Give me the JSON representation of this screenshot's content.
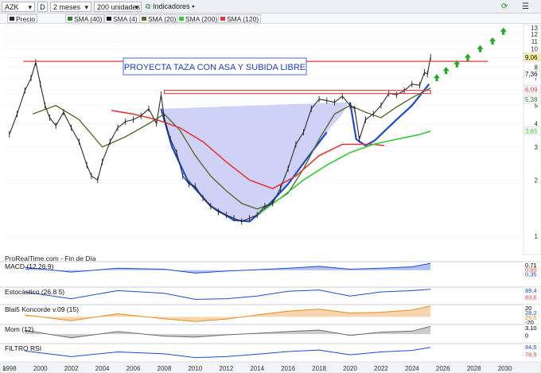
{
  "toolbar": {
    "ticker": "AZK",
    "mode_icon": "D",
    "period": "2 meses",
    "units": "200 unidades",
    "indicators": "Indicadores"
  },
  "legend": [
    {
      "label": "Precio",
      "color": "#2a2a2a"
    },
    {
      "label": "SMA (40)",
      "color": "#2e7d32"
    },
    {
      "label": "SMA (4)",
      "color": "#111111"
    },
    {
      "label": "SMA (20)",
      "color": "#556b2f"
    },
    {
      "label": "SMA (200)",
      "color": "#33cc33"
    },
    {
      "label": "SMA (120)",
      "color": "#e53935"
    }
  ],
  "annotation": "PROYECTA TAZA CON ASA Y SUBIDA LIBRE",
  "source": "ProRealTime.com - Fin de Día",
  "price_labels": [
    {
      "text": "9,06",
      "value": 9.06,
      "bg": "#fff3a0",
      "fg": "#000000"
    },
    {
      "text": "7,36",
      "value": 7.36,
      "bg": "#ffffff",
      "fg": "#111111"
    },
    {
      "text": "6,09",
      "value": 6.09,
      "bg": "#ffffff",
      "fg": "#e53935"
    },
    {
      "text": "5,38",
      "value": 5.38,
      "bg": "#ffffff",
      "fg": "#2e7d32"
    },
    {
      "text": "3,65",
      "value": 3.65,
      "bg": "#ffffff",
      "fg": "#33cc33"
    }
  ],
  "panels": [
    {
      "label": "MACD (12.26.9)",
      "axis": [
        "0,71",
        "0,65",
        "0,35"
      ],
      "axis_colors": [
        "#000000",
        "#e53935",
        "#1e4bd2"
      ]
    },
    {
      "label": "Estocástico (26.8 5)",
      "axis": [
        "89,4",
        "83,6"
      ],
      "axis_colors": [
        "#1e4bd2",
        "#e53935"
      ]
    },
    {
      "label": "Blai5 Koncorde v.09 (15)",
      "axis": [
        "20",
        "28,2",
        "25,5",
        "-20"
      ],
      "axis_colors": [
        "#000000",
        "#1e4bd2",
        "#e88a1a",
        "#000000"
      ]
    },
    {
      "label": "Mom (12)",
      "axis": [
        "3,10",
        "0"
      ],
      "axis_colors": [
        "#000000",
        "#000000"
      ]
    },
    {
      "label": "FILTRO RSI",
      "axis": [
        "84,6",
        "78,5"
      ],
      "axis_colors": [
        "#1e4bd2",
        "#e53935"
      ]
    }
  ],
  "chart_data": {
    "type": "line",
    "title": "AZK",
    "scale": "log",
    "ylim": [
      0.8,
      13.5
    ],
    "y_ticks": [
      1,
      2,
      3,
      4,
      5,
      6,
      7,
      8,
      9,
      10,
      11,
      12,
      13
    ],
    "x_ticks": [
      1998,
      2000,
      2002,
      2004,
      2006,
      2008,
      2010,
      2012,
      2014,
      2016,
      2018,
      2020,
      2022,
      2024,
      2026,
      2028,
      2030
    ],
    "xlim": [
      1997.6,
      2031.2
    ],
    "series": [
      {
        "name": "Precio",
        "color": "#2a2a2a",
        "x": [
          1998.0,
          1998.5,
          1999.0,
          1999.4,
          1999.7,
          2000.0,
          2000.3,
          2000.6,
          2001.0,
          2001.5,
          2002.0,
          2002.5,
          2003.0,
          2003.3,
          2003.7,
          2004.0,
          2004.5,
          2005.0,
          2005.5,
          2006.0,
          2006.5,
          2007.0,
          2007.5,
          2007.8,
          2008.0,
          2008.4,
          2008.8,
          2009.2,
          2009.6,
          2010.0,
          2010.5,
          2011.0,
          2011.5,
          2012.0,
          2012.5,
          2013.0,
          2013.5,
          2014.0,
          2014.5,
          2015.0,
          2015.5,
          2016.0,
          2016.5,
          2017.0,
          2017.5,
          2018.0,
          2018.5,
          2019.0,
          2019.5,
          2020.0,
          2020.3,
          2020.6,
          2021.0,
          2021.5,
          2022.0,
          2022.5,
          2023.0,
          2023.5,
          2024.0,
          2024.5,
          2024.8,
          2025.0,
          2025.2
        ],
        "y": [
          3.5,
          4.5,
          6.0,
          7.0,
          8.5,
          6.5,
          5.0,
          4.3,
          3.9,
          4.6,
          3.8,
          3.2,
          2.4,
          2.1,
          2.0,
          2.5,
          3.2,
          3.8,
          4.1,
          4.2,
          4.4,
          4.8,
          4.0,
          5.7,
          4.3,
          3.3,
          2.8,
          2.1,
          1.9,
          1.85,
          1.6,
          1.45,
          1.35,
          1.3,
          1.25,
          1.2,
          1.25,
          1.3,
          1.45,
          1.5,
          1.8,
          2.3,
          3.1,
          3.6,
          4.8,
          5.4,
          5.3,
          5.2,
          5.6,
          5.0,
          4.8,
          3.3,
          4.2,
          4.5,
          5.0,
          5.8,
          5.7,
          6.0,
          6.5,
          6.4,
          7.5,
          7.36,
          9.06
        ]
      },
      {
        "name": "SMA (20)",
        "color": "#556b2f",
        "x": [
          1999.5,
          2001,
          2002.5,
          2004,
          2005.5,
          2007,
          2008,
          2009,
          2010,
          2011,
          2012,
          2013,
          2014,
          2015,
          2016,
          2017,
          2018,
          2019,
          2020,
          2021,
          2022,
          2023,
          2024,
          2025.2
        ],
        "y": [
          4.5,
          5.0,
          4.2,
          3.0,
          3.4,
          4.0,
          4.5,
          3.7,
          2.7,
          2.1,
          1.75,
          1.5,
          1.4,
          1.5,
          1.7,
          2.3,
          3.3,
          4.5,
          5.0,
          4.6,
          4.3,
          4.9,
          5.5,
          6.2
        ]
      },
      {
        "name": "SMA (120)",
        "color": "#e53935",
        "x": [
          2004.6,
          2006,
          2007.5,
          2009,
          2010.5,
          2012,
          2013.5,
          2015,
          2016.5,
          2018,
          2019.5,
          2020.5,
          2021.5,
          2022.2
        ],
        "y": [
          4.7,
          4.5,
          4.2,
          3.8,
          3.2,
          2.5,
          2.0,
          1.8,
          2.1,
          2.7,
          3.1,
          3.1,
          3.1,
          3.05
        ]
      },
      {
        "name": "SMA (200)",
        "color": "#33cc33",
        "x": [
          2014.0,
          2015.5,
          2017,
          2018.5,
          2020,
          2021.5,
          2023,
          2024.5,
          2025.2
        ],
        "y": [
          1.3,
          1.6,
          2.0,
          2.4,
          2.8,
          3.1,
          3.3,
          3.5,
          3.65
        ]
      }
    ],
    "projection_arrows": {
      "color": "#22aa22",
      "x": [
        2025.6,
        2026.2,
        2026.9,
        2027.6,
        2028.4,
        2029.2,
        2029.9
      ],
      "y": [
        7.0,
        7.65,
        8.3,
        9.0,
        10.0,
        11.0,
        12.4
      ]
    },
    "resistance_lines": [
      {
        "color": "#e53935",
        "x": [
          1998.9,
          2028.9
        ],
        "y": [
          8.6,
          8.6
        ]
      },
      {
        "color": "#e53935",
        "x": [
          2008.0,
          2025.2
        ],
        "y": [
          5.9,
          5.9
        ],
        "style": "double"
      }
    ],
    "cup_pattern": {
      "color": "#1e4bd2",
      "fill": "#c7c9f4",
      "x": [
        2007.8,
        2008.5,
        2009.5,
        2011,
        2012.5,
        2013.5,
        2014.5,
        2016,
        2017.5,
        2018.5,
        2019.5,
        2019.9
      ],
      "y": [
        4.8,
        3.0,
        2.0,
        1.45,
        1.22,
        1.2,
        1.4,
        1.9,
        2.8,
        3.6,
        4.5,
        5.2
      ]
    },
    "handle_pattern": {
      "color": "#1e4bd2",
      "x": [
        2020.0,
        2020.4,
        2021.0,
        2021.6,
        2022.3,
        2023.0,
        2024.0,
        2025.1
      ],
      "y": [
        5.2,
        3.3,
        3.05,
        3.25,
        3.7,
        4.2,
        5.0,
        6.5
      ]
    },
    "macd": {
      "x": [
        1999,
        2002,
        2005,
        2008,
        2010,
        2012,
        2014,
        2016,
        2018,
        2020,
        2022,
        2024,
        2025.2
      ],
      "y": [
        0.3,
        -0.2,
        0.2,
        0.1,
        -0.3,
        -0.1,
        0.05,
        0.2,
        0.4,
        0.1,
        0.2,
        0.35,
        0.71
      ]
    },
    "stochastic": {
      "x": [
        1999,
        2002,
        2005,
        2008,
        2010,
        2012,
        2014,
        2016,
        2018,
        2020,
        2022,
        2024,
        2025.2
      ],
      "y": [
        70,
        20,
        80,
        60,
        15,
        20,
        40,
        75,
        85,
        40,
        70,
        80,
        89.4
      ]
    },
    "koncorde": {
      "x": [
        1999,
        2002,
        2005,
        2008,
        2010,
        2012,
        2014,
        2016,
        2018,
        2020,
        2022,
        2024,
        2025.2
      ],
      "y": [
        5,
        -10,
        8,
        -5,
        -12,
        -6,
        5,
        15,
        20,
        10,
        12,
        18,
        28.2
      ]
    },
    "momentum": {
      "x": [
        1999,
        2002,
        2005,
        2008,
        2010,
        2012,
        2014,
        2016,
        2018,
        2020,
        2022,
        2024,
        2025.2
      ],
      "y": [
        1.5,
        -1.5,
        1.0,
        -0.8,
        -1.2,
        -0.3,
        0.3,
        1.0,
        1.6,
        -0.5,
        0.8,
        1.2,
        3.1
      ]
    },
    "rsi": {
      "x": [
        1999,
        2002,
        2005,
        2008,
        2010,
        2012,
        2014,
        2016,
        2018,
        2020,
        2022,
        2024,
        2025.2
      ],
      "y": [
        65,
        35,
        60,
        50,
        30,
        35,
        48,
        62,
        70,
        45,
        60,
        68,
        84.6
      ]
    }
  }
}
